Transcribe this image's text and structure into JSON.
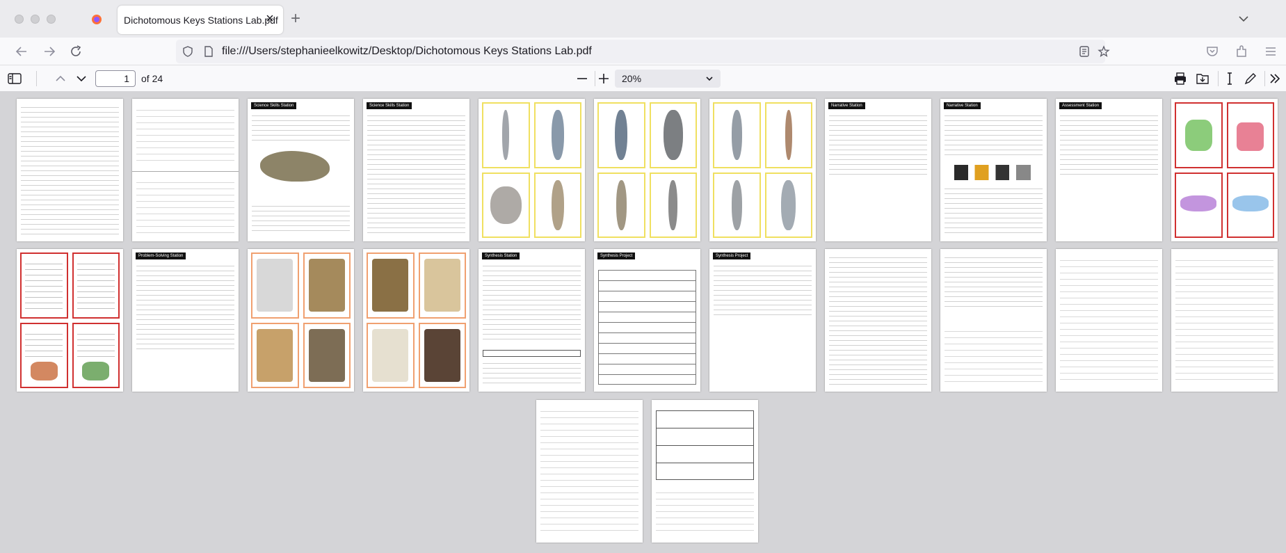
{
  "browser": {
    "tab_title": "Dichotomous Keys Stations Lab.pdf",
    "url": "file:///Users/stephanieelkowitz/Desktop/Dichotomous Keys Stations Lab.pdf"
  },
  "pdf_toolbar": {
    "page_number": "1",
    "page_count_label": "of 24",
    "zoom_value": "20%"
  },
  "thumbnails": {
    "page_headers": [
      "",
      "",
      "Science Skills Station",
      "Science Skills Station",
      "",
      "",
      "",
      "Narrative Station",
      "Narrative Station",
      "Assessment Station",
      "",
      "",
      "Problem-Solving Station",
      "",
      "",
      "Synthesis Station",
      "Synthesis Project",
      "Synthesis Project",
      "",
      "",
      "",
      "",
      "",
      ""
    ]
  },
  "colors": {
    "accent": "#0060df",
    "card_yellow": "#f0e060",
    "card_orange": "#f0a070",
    "card_red": "#d03030"
  }
}
